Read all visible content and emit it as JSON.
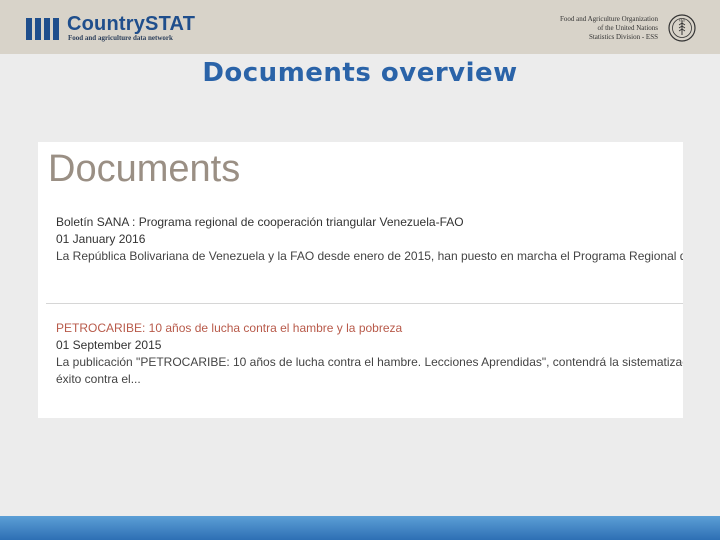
{
  "header": {
    "brand": "CountrySTAT",
    "tagline": "Food and agriculture data network",
    "org_line1": "Food and Agriculture Organization",
    "org_line2": "of the United Nations",
    "org_line3": "Statistics Division - ESS",
    "fao_logo_text": "FAO"
  },
  "page": {
    "title": "Documents overview"
  },
  "panel": {
    "heading": "Documents",
    "documents": [
      {
        "title": "Boletín SANA : Programa regional de cooperación triangular Venezuela-FAO",
        "date": "01 January 2016",
        "description": "La República Bolivariana de Venezuela y la FAO desde enero de 2015, han puesto en marcha el Programa Regional de Coo"
      },
      {
        "title": "PETROCARIBE: 10 años de lucha contra el hambre y la pobreza",
        "date": "01 September 2015",
        "description": "La publicación \"PETROCARIBE: 10 años de lucha contra el hambre. Lecciones Aprendidas\", contendrá la sistematización ",
        "description_line2": "éxito contra el..."
      }
    ]
  },
  "colors": {
    "brand_blue": "#1f4e8c",
    "title_blue": "#2a63a8",
    "link_red": "#b85a4a"
  }
}
